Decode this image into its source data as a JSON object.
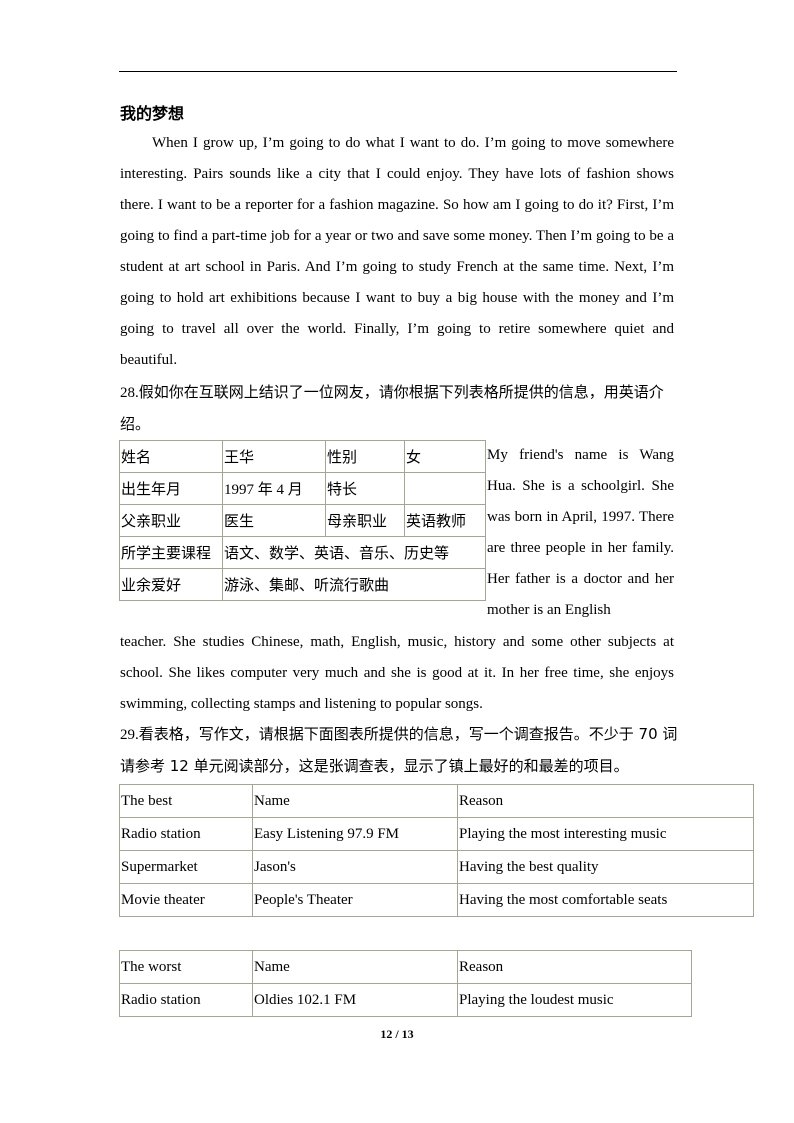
{
  "title": "我的梦想",
  "essay1": "When I grow up, I’m going to do what I want to do. I’m going to move somewhere interesting. Pairs sounds like a city that I could enjoy. They have lots of fashion shows there. I want to be a reporter for a fashion magazine. So how am I going to do it? First, I’m going to find a part-time job for a year or two and save some money. Then I’m going to be a student at art school in Paris. And I’m going to study French at the same time. Next, I’m going to hold art exhibitions because I want to buy a big house with the money and I’m going to travel all over the world. Finally, I’m going to retire somewhere quiet and beautiful.",
  "q28": {
    "number": "28.",
    "text": "假如你在互联网上结识了一位网友，请你根据下列表格所提供的信息，用英语介绍。"
  },
  "info_table": {
    "rows": [
      [
        "姓名",
        "王华",
        "性别",
        "女"
      ],
      [
        "出生年月",
        "1997 年 4 月",
        "特长",
        ""
      ],
      [
        "父亲职业",
        "医生",
        "母亲职业",
        "英语教师"
      ],
      [
        "所学主要课程",
        "语文、数学、英语、音乐、历史等"
      ],
      [
        "业余爱好",
        "游泳、集邮、听流行歌曲"
      ]
    ]
  },
  "answer28_side": " My friend's name is Wang Hua. She is a schoolgirl. She was born in April, 1997. There are three people in her family. Her father is a doctor and her mother is an English",
  "answer28_rest": "teacher. She studies Chinese, math, English, music, history and some other subjects at school. She likes computer very much and she is good at it. In her free time, she enjoys swimming, collecting stamps and listening to popular songs.",
  "q29": {
    "number": "29.",
    "text": "看表格，写作文，请根据下面图表所提供的信息，写一个调查报告。不少于 70 词请参考 12 单元阅读部分，这是张调查表，显示了镇上最好的和最差的项目。"
  },
  "best_table": {
    "header": [
      "The best",
      "Name",
      "Reason"
    ],
    "rows": [
      [
        "Radio station",
        "Easy Listening 97.9 FM",
        "Playing the most interesting music"
      ],
      [
        "Supermarket",
        "Jason's",
        "Having the best quality"
      ],
      [
        "Movie theater",
        "People's Theater",
        "Having the most comfortable seats"
      ]
    ]
  },
  "worst_table": {
    "header": [
      "The worst",
      "Name",
      "Reason"
    ],
    "rows": [
      [
        "Radio station",
        "Oldies 102.1 FM",
        "Playing the loudest music"
      ]
    ]
  },
  "footer": {
    "page": "12 / 13"
  }
}
